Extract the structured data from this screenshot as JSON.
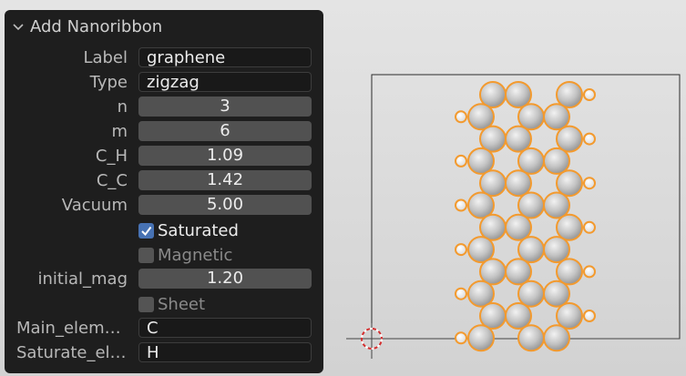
{
  "panel": {
    "title": "Add Nanoribbon",
    "fields": {
      "label": {
        "label": "Label",
        "value": "graphene"
      },
      "type": {
        "label": "Type",
        "value": "zigzag"
      },
      "n": {
        "label": "n",
        "value": "3"
      },
      "m": {
        "label": "m",
        "value": "6"
      },
      "c_h": {
        "label": "C_H",
        "value": "1.09"
      },
      "c_c": {
        "label": "C_C",
        "value": "1.42"
      },
      "vacuum": {
        "label": "Vacuum",
        "value": "5.00"
      },
      "saturated": {
        "label": "Saturated",
        "checked": true
      },
      "magnetic": {
        "label": "Magnetic",
        "checked": false
      },
      "initial_mag": {
        "label": "initial_mag",
        "value": "1.20"
      },
      "sheet": {
        "label": "Sheet",
        "checked": false
      },
      "main_element": {
        "label": "Main_elem…",
        "value": "C"
      },
      "saturate_element": {
        "label": "Saturate_el…",
        "value": "H"
      }
    }
  },
  "colors": {
    "panel_bg": "#1e1e1e",
    "selection_outline": "#f39a2e",
    "checkbox_on": "#4772b3",
    "viewport_bg": "#dcdcdc",
    "carbon_atom": "#c8c8c8",
    "hydrogen_atom": "#f4f4f4"
  },
  "icons": {
    "collapse": "chevron-down-icon",
    "checked": "checkmark-icon",
    "cursor": "3d-cursor-icon"
  }
}
